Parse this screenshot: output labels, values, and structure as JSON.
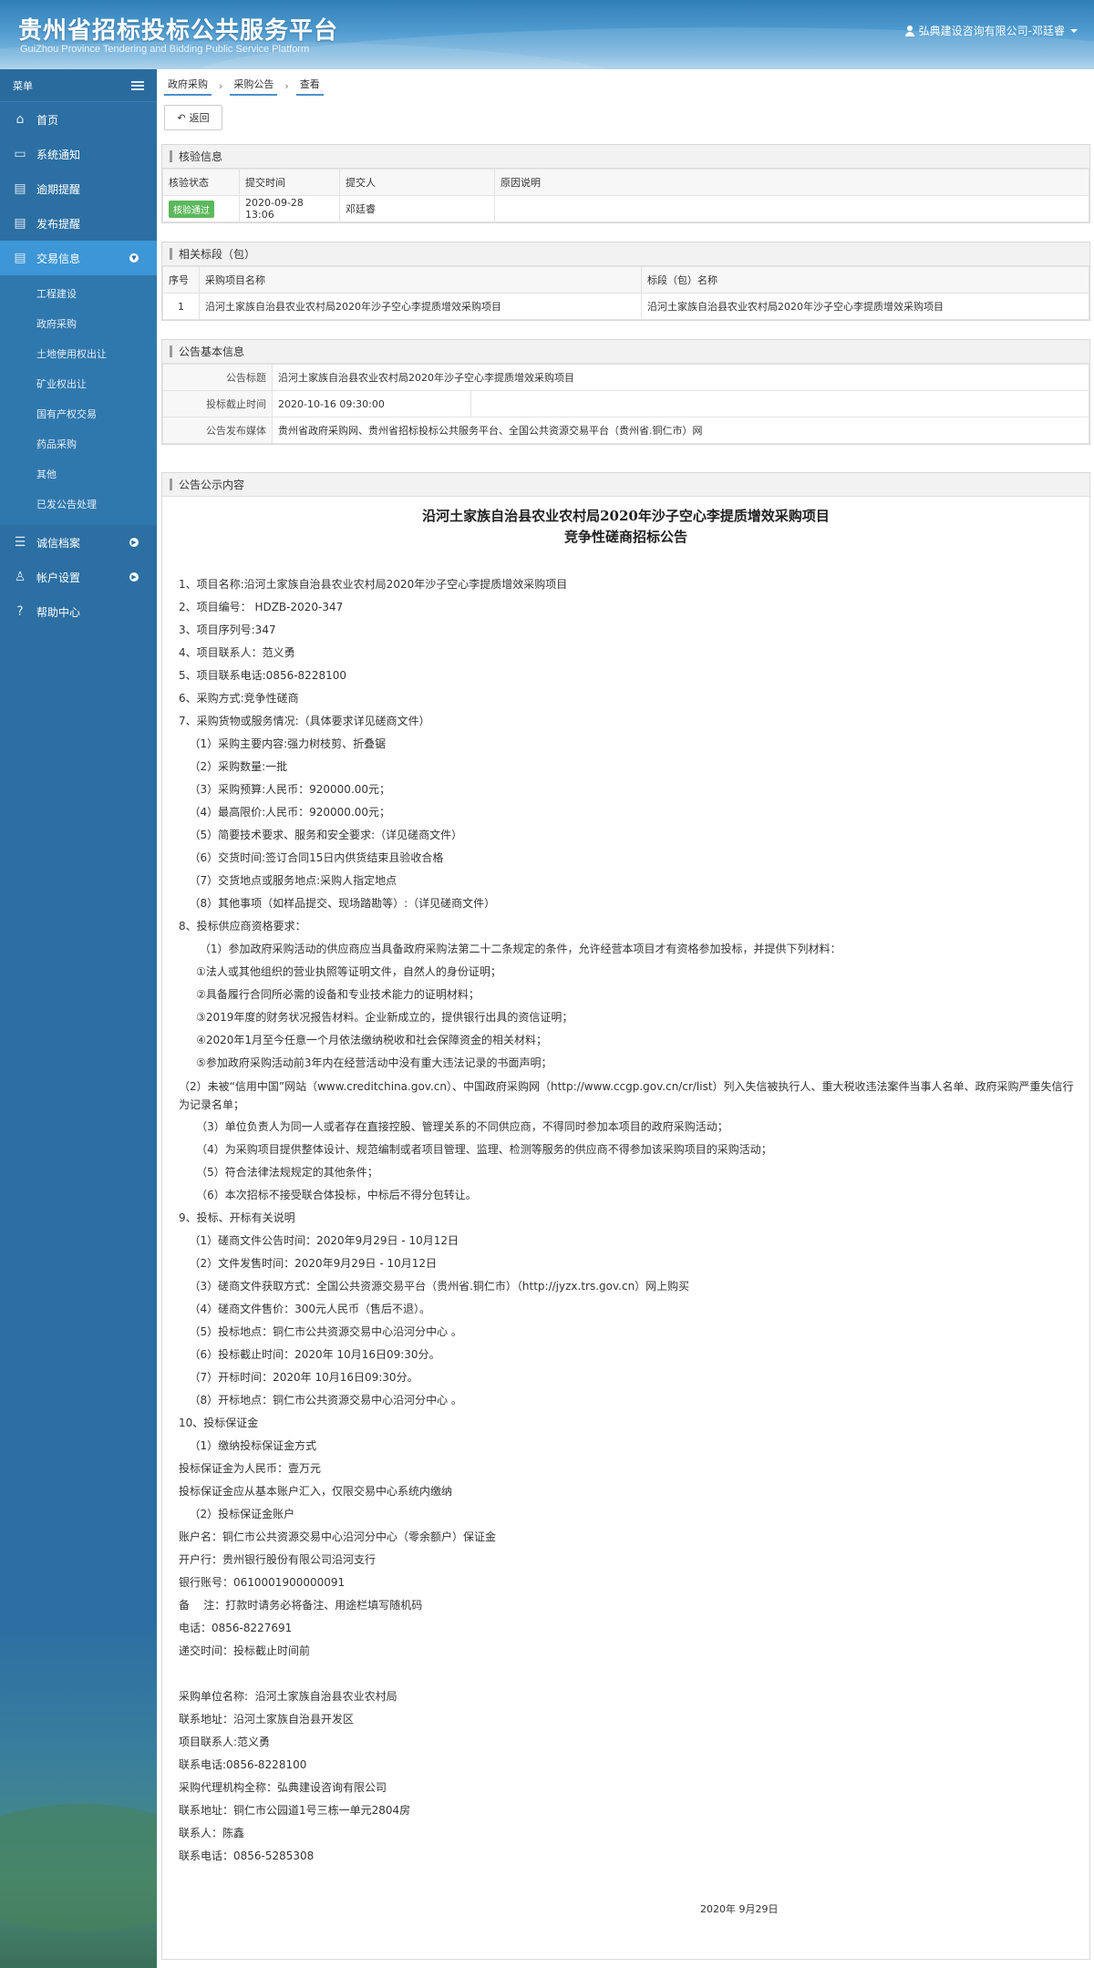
{
  "header": {
    "title": "贵州省招标投标公共服务平台",
    "subtitle": "GuiZhou Province Tendering and Bidding Public Service Platform",
    "user": "弘典建设咨询有限公司-邓廷睿"
  },
  "sidebar": {
    "menu_label": "菜单",
    "items": [
      {
        "label": "首页",
        "icon": "home-icon"
      },
      {
        "label": "系统通知",
        "icon": "monitor-icon"
      },
      {
        "label": "逾期提醒",
        "icon": "folder-icon"
      },
      {
        "label": "发布提醒",
        "icon": "folder-icon"
      },
      {
        "label": "交易信息",
        "icon": "folder-icon"
      }
    ],
    "sub_items": [
      "工程建设",
      "政府采购",
      "土地使用权出让",
      "矿业权出让",
      "国有产权交易",
      "药品采购",
      "其他",
      "已发公告处理"
    ],
    "items_after": [
      {
        "label": "诚信档案",
        "icon": "list-icon"
      },
      {
        "label": "帐户设置",
        "icon": "user-icon"
      },
      {
        "label": "帮助中心",
        "icon": "help-icon"
      }
    ]
  },
  "breadcrumb": [
    "政府采购",
    "采购公告",
    "查看"
  ],
  "back_label": "返回",
  "verify": {
    "title": "核验信息",
    "headers": [
      "核验状态",
      "提交时间",
      "提交人",
      "原因说明"
    ],
    "row": {
      "status": "核验通过",
      "time": "2020-09-28 13:06",
      "person": "邓廷睿",
      "reason": ""
    }
  },
  "sections": {
    "title": "相关标段（包）",
    "headers": [
      "序号",
      "采购项目名称",
      "标段（包）名称"
    ],
    "row": {
      "no": "1",
      "project": "沿河土家族自治县农业农村局2020年沙子空心李提质增效采购项目",
      "section": "沿河土家族自治县农业农村局2020年沙子空心李提质增效采购项目"
    }
  },
  "basic": {
    "title": "公告基本信息",
    "title_label": "公告标题",
    "title_value": "沿河土家族自治县农业农村局2020年沙子空心李提质增效采购项目",
    "deadline_label": "投标截止时间",
    "deadline_value": "2020-10-16 09:30:00",
    "media_label": "公告发布媒体",
    "media_value": "贵州省政府采购网、贵州省招标投标公共服务平台、全国公共资源交易平台（贵州省.铜仁市）网"
  },
  "content": {
    "title": "公告公示内容",
    "notice_title_1": "沿河土家族自治县农业农村局2020年沙子空心李提质增效采购项目",
    "notice_title_2": "竞争性磋商招标公告",
    "lines": [
      "1、项目名称:沿河土家族自治县农业农村局2020年沙子空心李提质增效采购项目",
      "2、项目编号： HDZB-2020-347",
      "3、项目序列号:347",
      "4、项目联系人：范义勇",
      "5、项目联系电话:0856-8228100",
      "6、采购方式:竞争性磋商",
      "7、采购货物或服务情况:（具体要求详见磋商文件）",
      "   （1）采购主要内容:强力树枝剪、折叠锯",
      "   （2）采购数量:一批",
      "   （3）采购预算:人民币：920000.00元；",
      "   （4）最高限价:人民币：920000.00元；",
      "   （5）简要技术要求、服务和安全要求:（详见磋商文件）",
      "   （6）交货时间:签订合同15日内供货结束且验收合格",
      "   （7）交货地点或服务地点:采购人指定地点",
      "   （8）其他事项（如样品提交、现场踏勘等）:（详见磋商文件）",
      "8、投标供应商资格要求：",
      "      （1）参加政府采购活动的供应商应当具备政府采购法第二十二条规定的条件，允许经营本项目才有资格参加投标，并提供下列材料：",
      "     ①法人或其他组织的营业执照等证明文件，自然人的身份证明；",
      "     ②具备履行合同所必需的设备和专业技术能力的证明材料；",
      "     ③2019年度的财务状况报告材料。企业新成立的，提供银行出具的资信证明；",
      "     ④2020年1月至今任意一个月依法缴纳税收和社会保障资金的相关材料；",
      "     ⑤参加政府采购活动前3年内在经营活动中没有重大违法记录的书面声明；"
    ],
    "wrap_line": "      （2）未被“信用中国”网站（www.creditchina.gov.cn）、中国政府采购网（http://www.ccgp.gov.cn/cr/list）列入失信被执行人、重大税收违法案件当事人名单、政府采购严重失信行为记录名单；",
    "lines_2": [
      "     （3）单位负责人为同一人或者存在直接控股、管理关系的不同供应商，不得同时参加本项目的政府采购活动；",
      "     （4）为采购项目提供整体设计、规范编制或者项目管理、监理、检测等服务的供应商不得参加该采购项目的采购活动；",
      "     （5）符合法律法规规定的其他条件；",
      "     （6）本次招标不接受联合体投标，中标后不得分包转让。",
      "9、投标、开标有关说明",
      "   （1）磋商文件公告时间：2020年9月29日 - 10月12日",
      "   （2）文件发售时间：2020年9月29日 - 10月12日",
      "   （3）磋商文件获取方式：全国公共资源交易平台（贵州省.铜仁市）（http://jyzx.trs.gov.cn）网上购买",
      "   （4）磋商文件售价：300元人民币（售后不退）。",
      "   （5）投标地点：铜仁市公共资源交易中心沿河分中心 。",
      "   （6）投标截止时间：2020年 10月16日09:30分。",
      "   （7）开标时间：2020年 10月16日09:30分。",
      "   （8）开标地点：铜仁市公共资源交易中心沿河分中心 。",
      "10、投标保证金",
      "   （1）缴纳投标保证金方式",
      "投标保证金为人民币：壹万元",
      "投标保证金应从基本账户汇入，仅限交易中心系统内缴纳",
      "   （2）投标保证金账户",
      "账户名：铜仁市公共资源交易中心沿河分中心（零余额户）保证金",
      "开户行：贵州银行股份有限公司沿河支行",
      "银行账号：0610001900000091",
      "备    注：打款时请务必将备注、用途栏填写随机码",
      "电话：0856-8227691",
      "递交时间：投标截止时间前",
      "",
      "采购单位名称:  沿河土家族自治县农业农村局",
      "联系地址：沿河土家族自治县开发区",
      "项目联系人:范义勇",
      "联系电话:0856-8228100",
      "采购代理机构全称：弘典建设咨询有限公司",
      "联系地址：铜仁市公园道1号三栋一单元2804房",
      "联系人：陈鑫",
      "联系电话：0856-5285308"
    ],
    "date": "2020年 9月29日"
  }
}
